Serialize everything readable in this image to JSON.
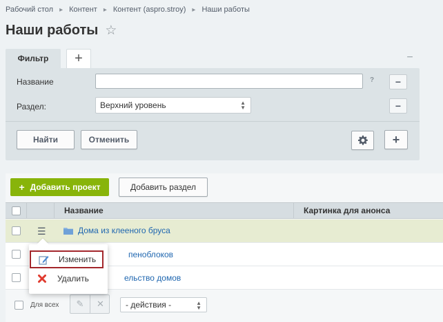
{
  "breadcrumb": [
    {
      "label": "Рабочий стол"
    },
    {
      "label": "Контент"
    },
    {
      "label": "Контент (aspro.stroy)"
    },
    {
      "label": "Наши работы"
    }
  ],
  "page": {
    "title": "Наши работы",
    "favorite_icon": "star-icon"
  },
  "filter": {
    "tab_label": "Фильтр",
    "fields": [
      {
        "label": "Название",
        "value": "",
        "help": "?"
      },
      {
        "label": "Раздел:",
        "value": "Верхний уровень"
      }
    ],
    "find_label": "Найти",
    "cancel_label": "Отменить"
  },
  "toolbar": {
    "add_project_label": "Добавить проект",
    "add_section_label": "Добавить раздел"
  },
  "grid": {
    "columns": [
      "Название",
      "Картинка для анонса"
    ],
    "rows": [
      {
        "name": "Дома из клееного бруса",
        "selected": true
      },
      {
        "name": "пеноблоков",
        "selected": false
      },
      {
        "name": "ельство домов",
        "selected": false
      }
    ]
  },
  "context_menu": {
    "items": [
      {
        "label": "Изменить",
        "icon": "edit-icon"
      },
      {
        "label": "Удалить",
        "icon": "delete-icon"
      }
    ]
  },
  "footer": {
    "for_all_label": "Для всех",
    "actions_placeholder": "- действия -"
  },
  "colors": {
    "accent_green": "#88b40a",
    "link_blue": "#2067b0",
    "selected_row": "#e7ecd2",
    "highlight_red": "#a3262b"
  }
}
